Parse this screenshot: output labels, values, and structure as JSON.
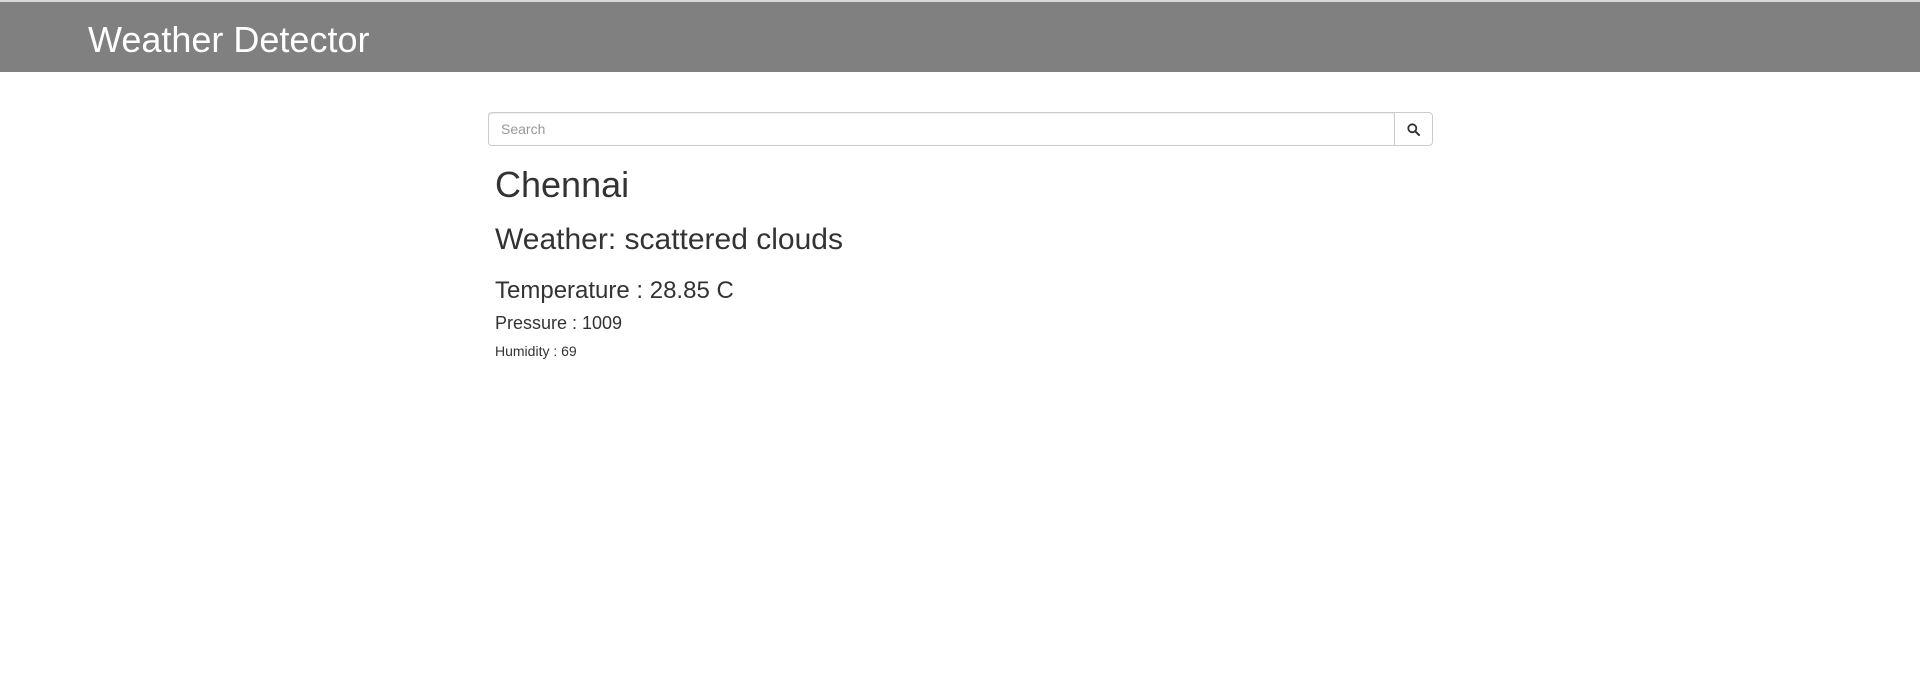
{
  "navbar": {
    "brand": "Weather Detector",
    "background_color": "#808080"
  },
  "search": {
    "placeholder": "Search",
    "value": "",
    "button_icon": "search-icon"
  },
  "result": {
    "city": "Chennai",
    "weather": "Weather: scattered clouds",
    "temperature": "Temperature : 28.85 C",
    "pressure": "Pressure : 1009",
    "humidity": "Humidity : 69"
  }
}
